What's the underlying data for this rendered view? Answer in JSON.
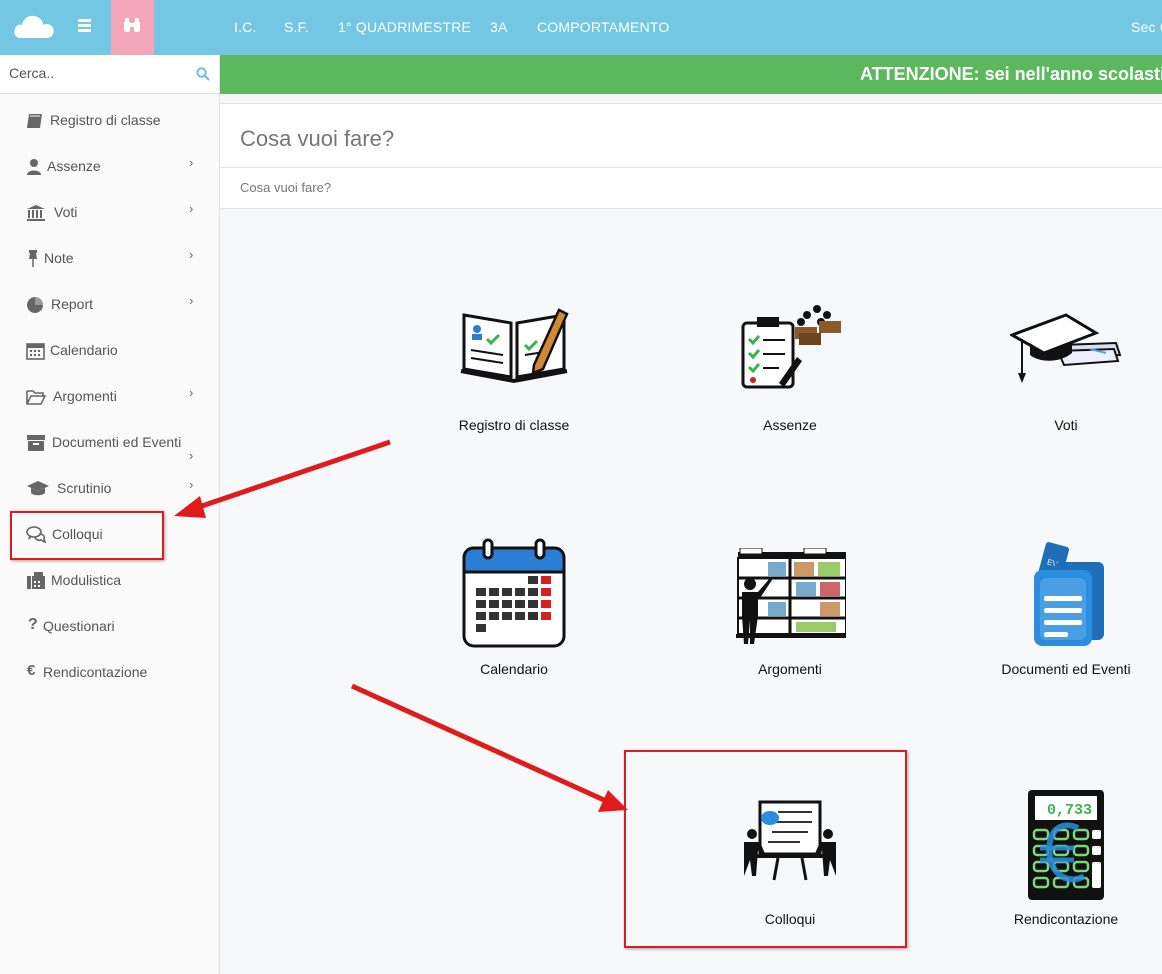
{
  "topbar": {
    "nav": [
      "I.C.",
      "S.F.",
      "1° QUADRIMESTRE",
      "3A",
      "COMPORTAMENTO"
    ],
    "right_text": "Sec C"
  },
  "sidebar": {
    "search_placeholder": "Cerca..",
    "items": [
      {
        "label": "Registro di classe",
        "icon": "book-icon",
        "submenu": false
      },
      {
        "label": "Assenze",
        "icon": "user-icon",
        "submenu": true
      },
      {
        "label": "Voti",
        "icon": "bank-icon",
        "submenu": true
      },
      {
        "label": "Note",
        "icon": "pin-icon",
        "submenu": true
      },
      {
        "label": "Report",
        "icon": "pie-chart-icon",
        "submenu": true
      },
      {
        "label": "Calendario",
        "icon": "calendar-icon",
        "submenu": false
      },
      {
        "label": "Argomenti",
        "icon": "folder-open-icon",
        "submenu": true
      },
      {
        "label": "Documenti ed Eventi",
        "icon": "archive-icon",
        "submenu": true
      },
      {
        "label": "Scrutinio",
        "icon": "graduation-cap-icon",
        "submenu": true
      },
      {
        "label": "Colloqui",
        "icon": "chat-bubbles-icon",
        "submenu": false
      },
      {
        "label": "Modulistica",
        "icon": "fax-icon",
        "submenu": false
      },
      {
        "label": "Questionari",
        "icon": "question-icon",
        "submenu": false
      },
      {
        "label": "Rendicontazione",
        "icon": "euro-icon",
        "submenu": false
      }
    ]
  },
  "banner": {
    "text": "ATTENZIONE: sei nell'anno scolastico"
  },
  "panel": {
    "title": "Cosa vuoi fare?",
    "subtitle": "Cosa vuoi fare?"
  },
  "tiles": [
    {
      "label": "Registro di classe"
    },
    {
      "label": "Assenze"
    },
    {
      "label": "Voti"
    },
    {
      "label": "Calendario"
    },
    {
      "label": "Argomenti"
    },
    {
      "label": "Documenti ed Eventi"
    },
    {
      "label": "Colloqui"
    },
    {
      "label": "Rendicontazione",
      "display_value": "0,733"
    }
  ],
  "colors": {
    "topbar": "#74c7e3",
    "home_button": "#f4a5b8",
    "banner": "#5cb85c",
    "highlight": "#d62020"
  }
}
